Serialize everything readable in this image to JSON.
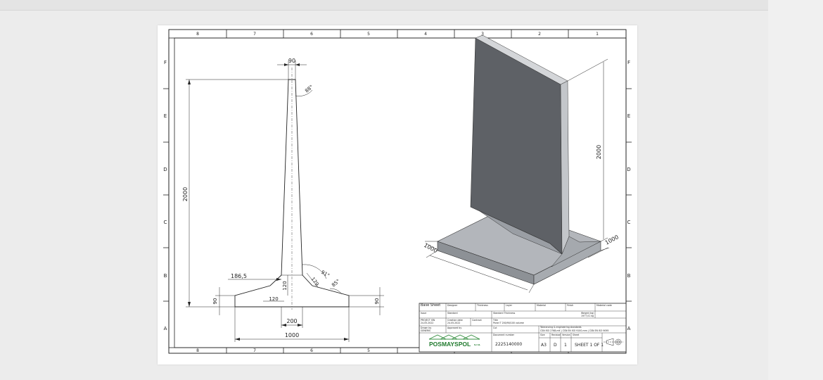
{
  "frame": {
    "columns": [
      "8",
      "7",
      "6",
      "5",
      "4",
      "3",
      "2",
      "1"
    ],
    "rows": [
      "F",
      "E",
      "D",
      "C",
      "B",
      "A"
    ]
  },
  "dimensions": {
    "top_width": "90",
    "angle_top": "88°",
    "height_left": "2000",
    "haunch_width": "186,5",
    "angle_haunch": "91°",
    "haunch_len": "179",
    "angle_base": "85°",
    "haunch_height": "120",
    "haunch_base": "120",
    "base_left_thick": "90",
    "base_right_thick": "90",
    "stem_base": "200",
    "base_width": "1000",
    "iso_height": "2000",
    "iso_depth_left": "1000",
    "iso_depth_right": "1000"
  },
  "title_block": {
    "title_label": "Base Sheet",
    "designer_label": "Designer",
    "thickness_label": "Thickness",
    "layer_label": "Layer",
    "material_label": "Material",
    "finish_label": "Finish",
    "material_code_label": "Material code",
    "issue_label": "Issue",
    "standard_label": "Standard",
    "standard_thickness_label": "Standard Thickness",
    "weight_label": "Weight (kg)",
    "weight_value": "1977,01 kg",
    "project_label": "PROJECT ISN",
    "project_value": "24.05.2022",
    "creation_label": "Creation date",
    "creation_value": "24.05.2022",
    "contract_label": "Contract",
    "title_field_label": "Title",
    "title_value": "Panel T 200/90/100 volume",
    "drawn_label": "Drawn by",
    "drawn_value": "GENERIS",
    "approved_label": "Approved by",
    "cut_label": "Cut",
    "tolerancing_label": "Tolerancing & engineering standards",
    "tolerancing_value": "ČSN ISO 2768-mK | ČSN EN ISO 9100-mm | ČSN EN ISO 9095",
    "document_label": "Document number",
    "document_number": "2225140000",
    "size_label": "Size",
    "size_value": "A3",
    "revision_label": "Revision",
    "revision_value": "D",
    "version_label": "Version",
    "version_value": "1",
    "sheet_label": "Sheet",
    "sheet_value": "SHEET 1 OF 1",
    "company": "POSMAYSPOL",
    "company_suffix": "s.r.o."
  }
}
